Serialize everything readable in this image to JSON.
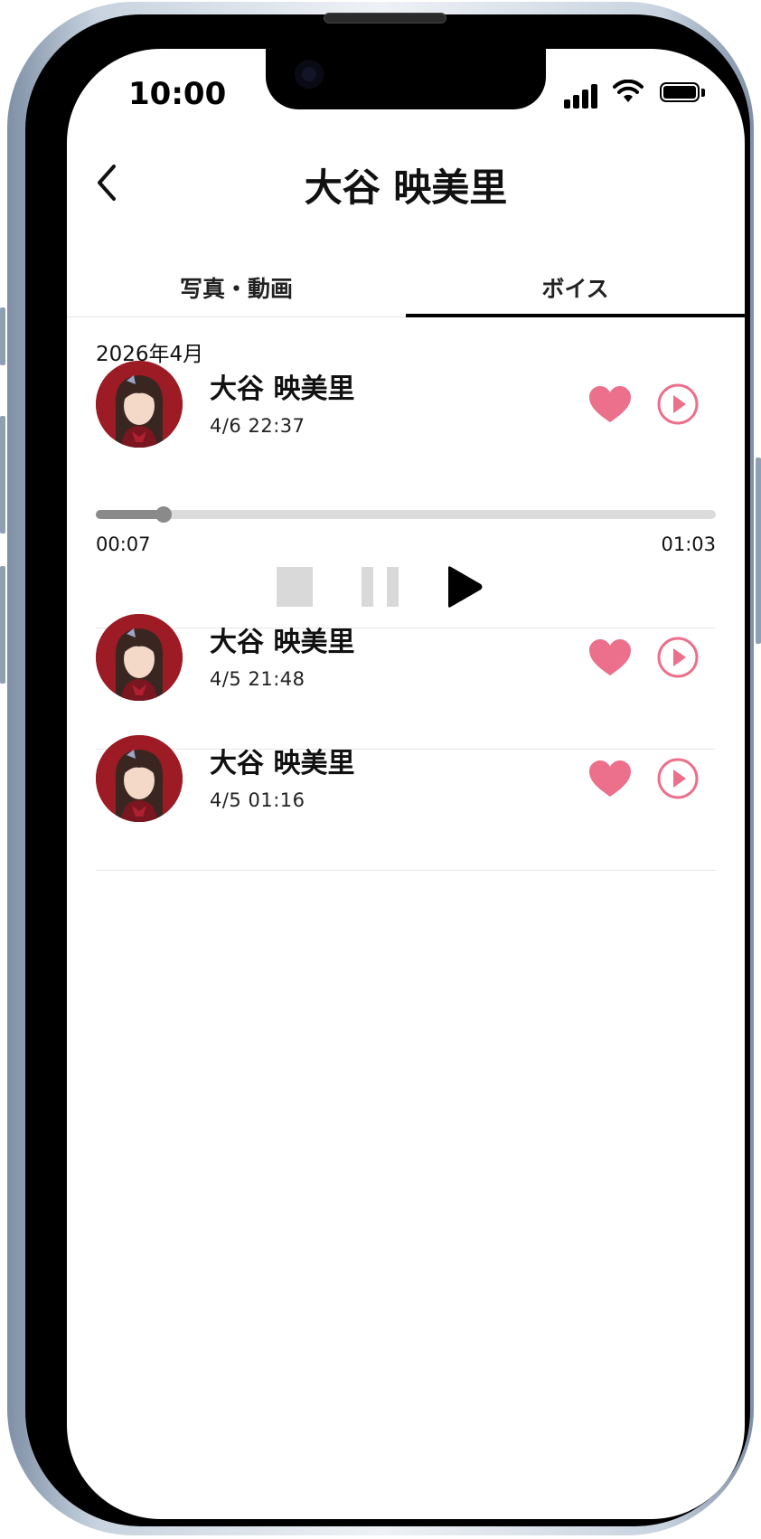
{
  "status_bar": {
    "time": "10:00"
  },
  "header": {
    "title": "大谷 映美里",
    "back_icon": "chevron-left-icon"
  },
  "tabs": [
    {
      "label": "写真・動画",
      "active": false
    },
    {
      "label": "ボイス",
      "active": true
    }
  ],
  "month": "2026年4月",
  "items": [
    {
      "name": "大谷 映美里",
      "datetime": "4/6 22:37",
      "liked": true,
      "expanded": true
    },
    {
      "name": "大谷 映美里",
      "datetime": "4/5 21:48",
      "liked": true,
      "expanded": false
    },
    {
      "name": "大谷 映美里",
      "datetime": "4/5 01:16",
      "liked": true,
      "expanded": false
    }
  ],
  "player": {
    "elapsed": "00:07",
    "total": "01:03",
    "progress_fraction": 0.11,
    "controls": [
      "stop-icon",
      "pause-icon",
      "play-icon"
    ]
  },
  "colors": {
    "accent_pink": "#ec6f8b",
    "avatar_bg": "#9c1b24",
    "active_control": "#000000",
    "disabled_control": "#d9d9d9"
  }
}
